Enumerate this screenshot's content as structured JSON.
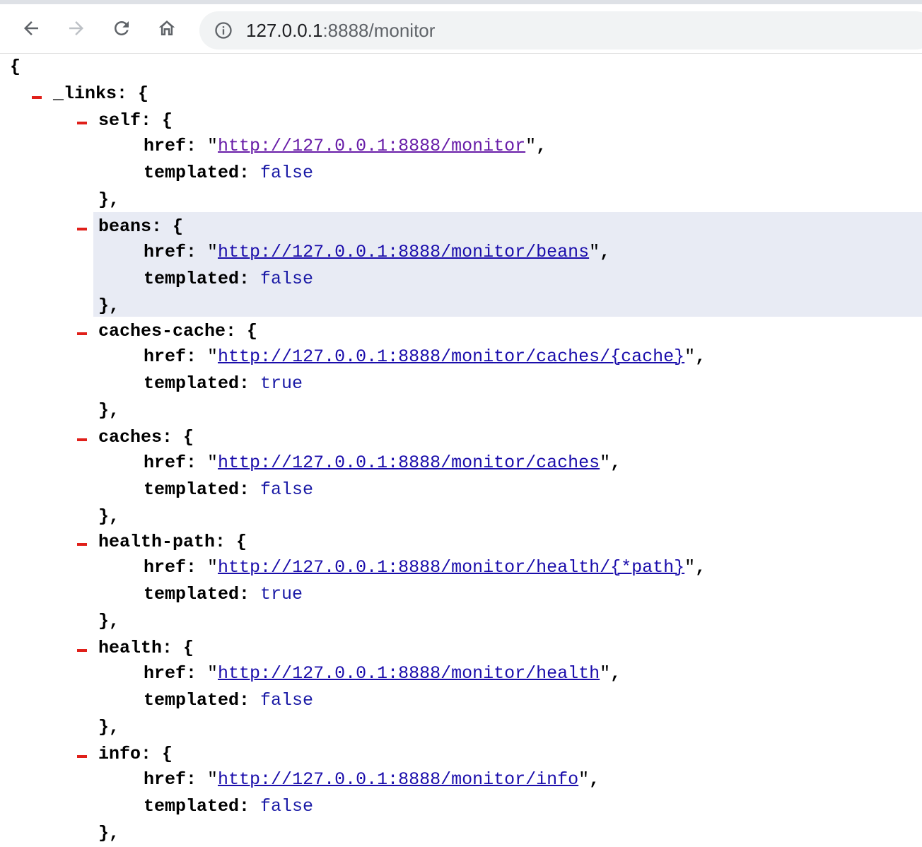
{
  "browser": {
    "url_host": "127.0.0.1",
    "url_path": ":8888/monitor"
  },
  "json": {
    "open_brace": "{",
    "root_key": "_links",
    "entries": [
      {
        "key": "self",
        "href": "http://127.0.0.1:8888/monitor",
        "templated": "false"
      },
      {
        "key": "beans",
        "href": "http://127.0.0.1:8888/monitor/beans",
        "templated": "false"
      },
      {
        "key": "caches-cache",
        "href": "http://127.0.0.1:8888/monitor/caches/{cache}",
        "templated": "true"
      },
      {
        "key": "caches",
        "href": "http://127.0.0.1:8888/monitor/caches",
        "templated": "false"
      },
      {
        "key": "health-path",
        "href": "http://127.0.0.1:8888/monitor/health/{*path}",
        "templated": "true"
      },
      {
        "key": "health",
        "href": "http://127.0.0.1:8888/monitor/health",
        "templated": "false"
      },
      {
        "key": "info",
        "href": "http://127.0.0.1:8888/monitor/info",
        "templated": "false"
      }
    ],
    "labels": {
      "href": "href",
      "templated": "templated"
    }
  }
}
